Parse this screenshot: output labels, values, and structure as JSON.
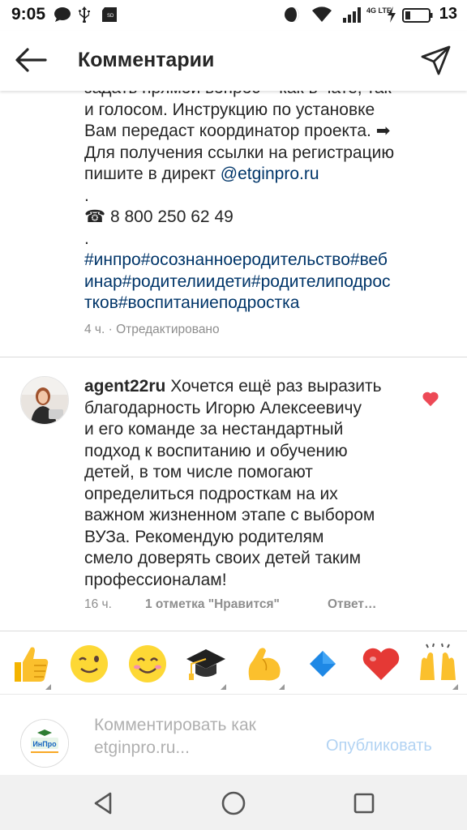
{
  "status_bar": {
    "time": "9:05",
    "network": "4G LTE",
    "battery": "13",
    "icons": [
      "chat-icon",
      "usb-icon",
      "sd-card-icon",
      "do-not-disturb-icon",
      "wifi-icon",
      "signal-icon",
      "charging-icon",
      "battery-icon"
    ]
  },
  "header": {
    "title": "Комментарии",
    "back_icon": "arrow-left-icon",
    "send_icon": "paper-plane-icon"
  },
  "comment1": {
    "line1": "задать прямой вопрос – как в чате, так",
    "line2": "и голосом. Инструкцию по установке",
    "line3": "Вам передаст координатор проекта. ➡",
    "line4": "Для получения ссылки на регистрацию",
    "line5_text": "пишите в директ ",
    "line5_link": "@etginpro.ru",
    "dot1": ".",
    "phone": "☎ 8 800 250 62 49",
    "dot2": ".",
    "tags_line1": "#инпро#осознанноеродительство#веб",
    "tags_line2": "инар#родителиидети#родителиподрос",
    "tags_line3": "тков#воспитаниеподростка",
    "meta": "4 ч. · Отредактировано"
  },
  "comment2": {
    "username": "agent22ru",
    "line1": " Хочется ещё раз выразить",
    "line2": "благодарность Игорю Алексеевичу",
    "line3": "и его команде за нестандартный",
    "line4": "подход к воспитанию и обучению",
    "line5": "детей, в том числе помогают",
    "line6": "определиться подросткам на их",
    "line7": "важном жизненном этапе с выбором",
    "line8": "ВУЗа. Рекомендую родителям",
    "line9": "смело доверять своих детей таким",
    "line10": "профессионалам!",
    "time": "16 ч.",
    "likes": "1 отметка \"Нравится\"",
    "reply": "Ответ…",
    "liked": true,
    "like_color": "#ed4956"
  },
  "emoji_bar": {
    "emojis": [
      "thumbs-up",
      "winking-face",
      "smiling-face",
      "graduation-cap",
      "flexed-biceps",
      "blue-diamond",
      "red-heart",
      "raising-hands"
    ]
  },
  "composer": {
    "placeholder": "Комментировать как etginpro.ru...",
    "placeholder_line1": "Комментировать как",
    "placeholder_line2": "etginpro.ru...",
    "publish_label": "Опубликовать",
    "logo_text": "ИнПро"
  },
  "nav_bar": {
    "buttons": [
      "back-triangle-icon",
      "home-circle-icon",
      "recents-square-icon"
    ]
  },
  "colors": {
    "link": "#003569",
    "meta_gray": "#8e8e8e",
    "publish_disabled": "#b2d3f3",
    "divider": "#dbdbdb"
  }
}
